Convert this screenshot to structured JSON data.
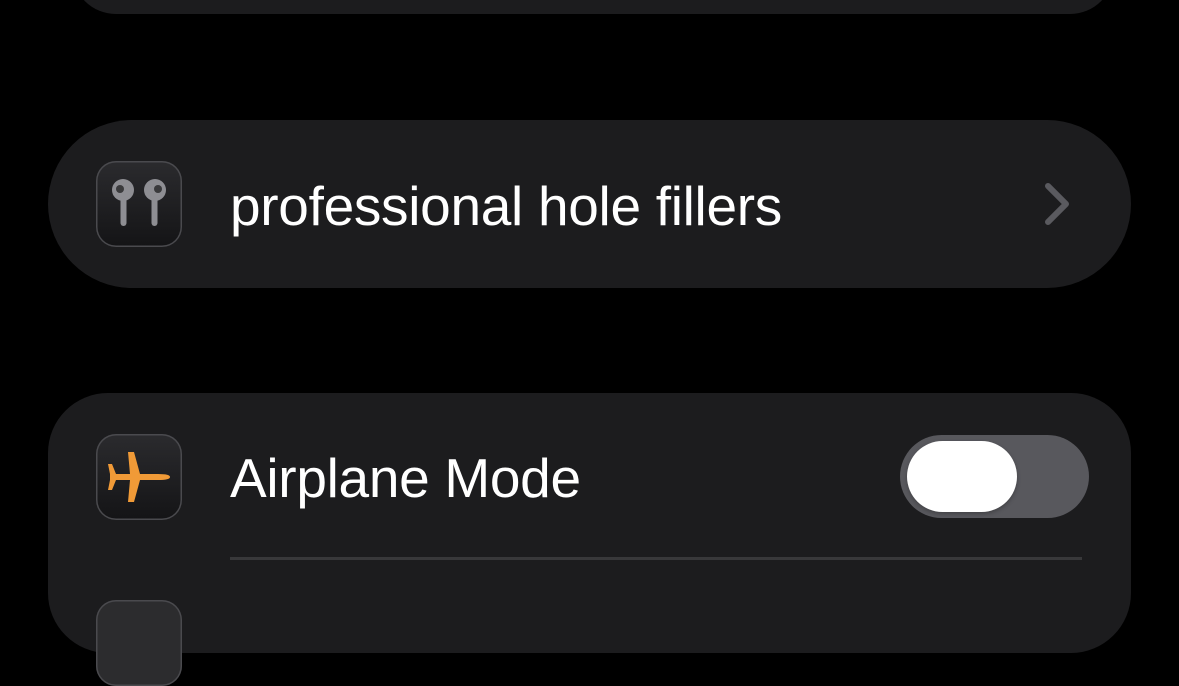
{
  "colors": {
    "background": "#000000",
    "group_background": "#1c1c1e",
    "separator": "#38383a",
    "toggle_off_track": "#58585d",
    "airplane_accent": "#f09a37",
    "chevron": "#5a5a5f"
  },
  "airpods_row": {
    "icon": "airpods-icon",
    "label": "professional hole fillers",
    "accessory": "chevron-right-icon"
  },
  "airplane_row": {
    "icon": "airplane-icon",
    "label": "Airplane Mode",
    "toggle_on": false
  }
}
